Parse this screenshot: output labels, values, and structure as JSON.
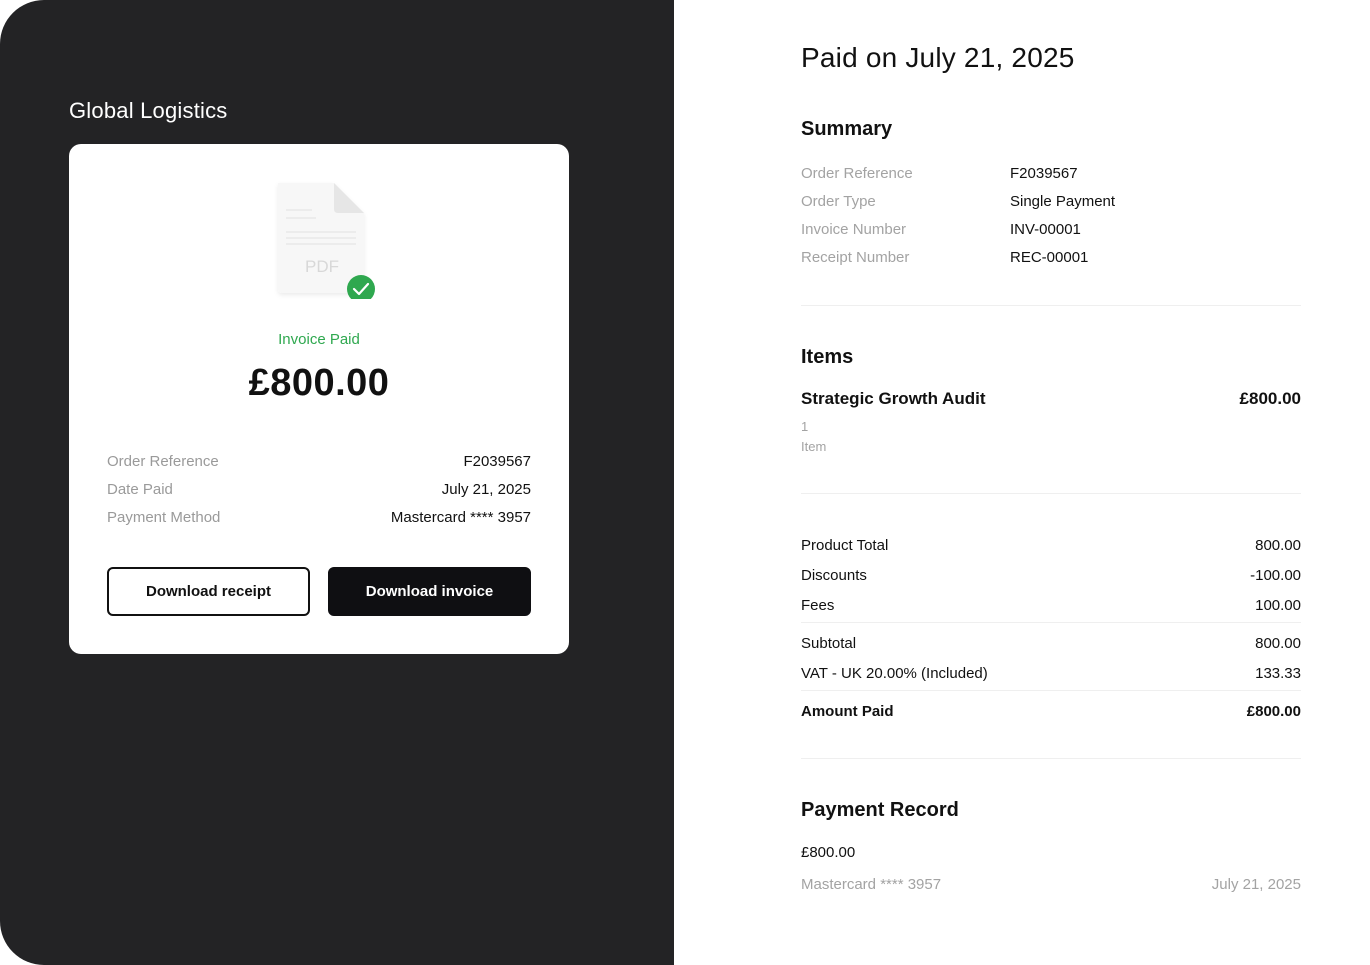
{
  "merchant": {
    "name": "Global Logistics"
  },
  "receipt_card": {
    "pdf_icon_label": "PDF",
    "status": "Invoice Paid",
    "amount": "£800.00",
    "details": [
      {
        "label": "Order Reference",
        "value": "F2039567"
      },
      {
        "label": "Date Paid",
        "value": "July 21, 2025"
      },
      {
        "label": "Payment Method",
        "value": "Mastercard **** 3957"
      }
    ],
    "buttons": {
      "download_receipt": "Download receipt",
      "download_invoice": "Download invoice"
    }
  },
  "page": {
    "title": "Paid on July 21, 2025"
  },
  "summary": {
    "title": "Summary",
    "rows": [
      {
        "label": "Order Reference",
        "value": "F2039567"
      },
      {
        "label": "Order Type",
        "value": "Single Payment"
      },
      {
        "label": "Invoice Number",
        "value": "INV-00001"
      },
      {
        "label": "Receipt Number",
        "value": "REC-00001"
      }
    ]
  },
  "items": {
    "title": "Items",
    "list": [
      {
        "name": "Strategic Growth Audit",
        "price": "£800.00",
        "quantity": "1",
        "unit": "Item"
      }
    ]
  },
  "totals": {
    "rows": [
      {
        "label": "Product Total",
        "value": "800.00"
      },
      {
        "label": "Discounts",
        "value": "-100.00"
      },
      {
        "label": "Fees",
        "value": "100.00"
      },
      {
        "label": "Subtotal",
        "value": "800.00"
      },
      {
        "label": "VAT - UK 20.00% (Included)",
        "value": "133.33"
      },
      {
        "label": "Amount Paid",
        "value": "£800.00"
      }
    ]
  },
  "payment_record": {
    "title": "Payment Record",
    "amount": "£800.00",
    "method": "Mastercard **** 3957",
    "date": "July 21, 2025"
  },
  "colors": {
    "left_panel_bg": "#232325",
    "success_green": "#2fa84f",
    "primary_button": "#0f0f12"
  },
  "icons": {
    "document": "pdf-document-icon",
    "status": "check-circle-icon"
  }
}
